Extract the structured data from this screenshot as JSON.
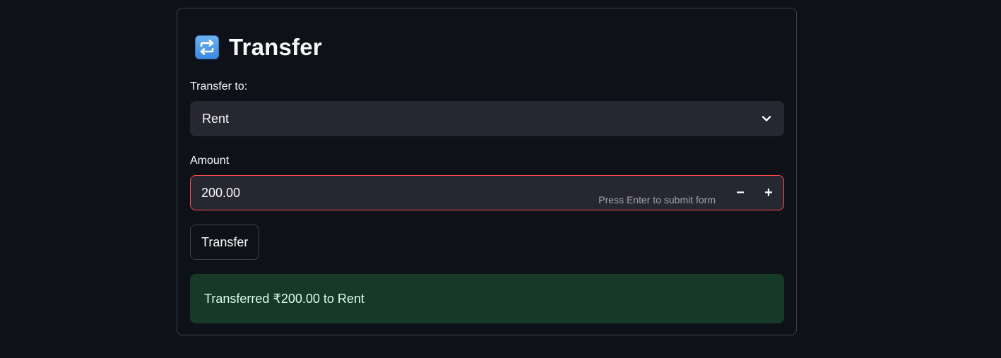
{
  "form": {
    "title": "Transfer",
    "title_icon": "repeat-arrows-icon",
    "recipient_label": "Transfer to:",
    "recipient_value": "Rent",
    "amount_label": "Amount",
    "amount_value": "200.00",
    "amount_hint": "Press Enter to submit form",
    "decrement_label": "−",
    "increment_label": "+",
    "submit_label": "Transfer",
    "success_message": "Transferred ₹200.00 to Rent"
  },
  "colors": {
    "background": "#0e1117",
    "input_background": "#262730",
    "error_border": "#ff4b4b",
    "success_background": "#173928",
    "success_text": "#dffde9",
    "icon_blue": "#3b8ae0"
  }
}
